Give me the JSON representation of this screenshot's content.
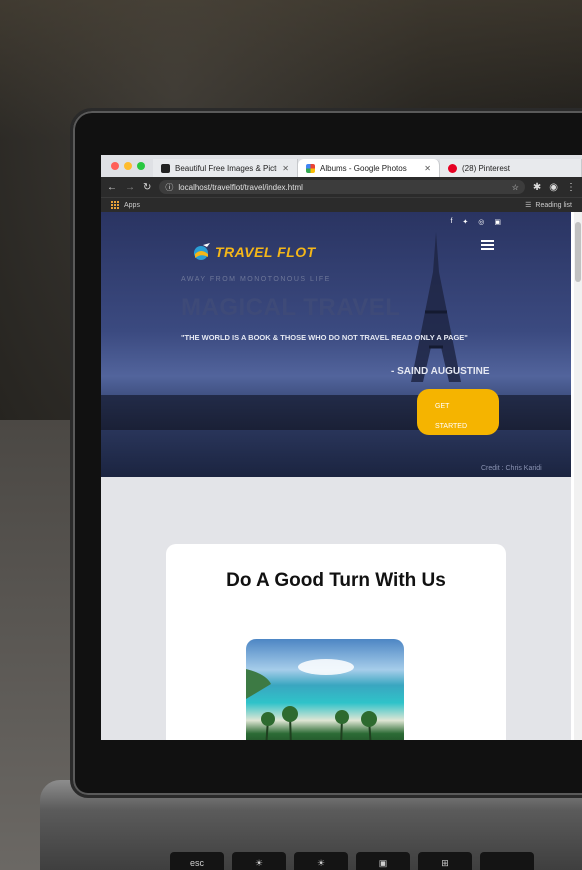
{
  "browser": {
    "tabs": [
      {
        "title": "Beautiful Free Images & Pictur",
        "favicon": "camera-icon",
        "active": false
      },
      {
        "title": "Albums - Google Photos",
        "favicon": "google-photos-icon",
        "active": true
      },
      {
        "title": "(28) Pinterest",
        "favicon": "pinterest-icon",
        "active": false
      }
    ],
    "url": "localhost/travelflot/travel/index.html",
    "bookmarks": {
      "apps_label": "Apps",
      "reading_list_label": "Reading list"
    }
  },
  "site": {
    "brand": "TRAVEL FLOT",
    "tagline": "AWAY FROM MONOTONOUS LIFE",
    "headline": "MAGICAL TRAVEL",
    "quote": "\"THE WORLD IS A BOOK & THOSE WHO DO NOT TRAVEL READ ONLY A PAGE\"",
    "author": "- SAIND AUGUSTINE",
    "cta_line1": "GET",
    "cta_line2": "STARTED",
    "credit": "Credit : Chris Karidi",
    "section_title": "Do A Good Turn With Us",
    "social_icons": [
      "facebook-icon",
      "twitter-icon",
      "whatsapp-icon",
      "instagram-icon"
    ]
  },
  "keyboard": {
    "keys": [
      "esc",
      "☀",
      "☀",
      "▣",
      "⊞",
      "",
      ""
    ]
  },
  "colors": {
    "accent": "#f5b400",
    "brand": "#f5b718",
    "hero": "#2a3462"
  }
}
